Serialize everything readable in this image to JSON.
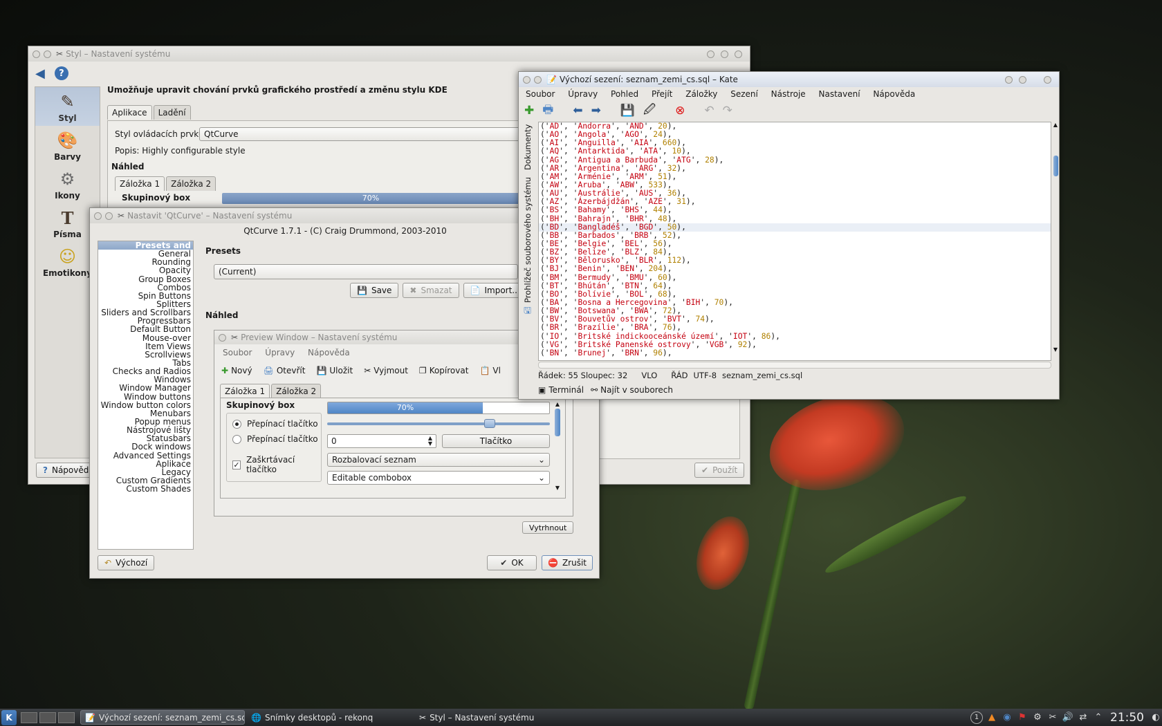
{
  "styl": {
    "title": "Styl – Nastavení systému",
    "heading": "Umožňuje upravit chování prvků grafického prostředí a změnu stylu KDE",
    "sidebar": [
      {
        "label": "Styl",
        "icon": "brush-icon"
      },
      {
        "label": "Barvy",
        "icon": "palette-icon"
      },
      {
        "label": "Ikony",
        "icon": "icons-icon"
      },
      {
        "label": "Písma",
        "icon": "font-icon"
      },
      {
        "label": "Emotikony",
        "icon": "smiley-icon"
      }
    ],
    "tabs": [
      "Aplikace",
      "Ladění"
    ],
    "widget_style_label": "Styl ovládacích prvků:",
    "widget_style_value": "QtCurve",
    "description": "Popis: Highly configurable style",
    "preview_label": "Náhled",
    "preview_tabs": [
      "Záložka 1",
      "Záložka 2"
    ],
    "groupbox": "Skupinový box",
    "progress": "70%",
    "help_button": "Nápověda",
    "apply_button": "Použít"
  },
  "qtcurve": {
    "title": "Nastavit 'QtCurve' – Nastavení systému",
    "header": "QtCurve 1.7.1 - (C) Craig Drummond, 2003-2010",
    "list": [
      "Presets and Preview",
      "General",
      "Rounding",
      "Opacity",
      "Group Boxes",
      "Combos",
      "Spin Buttons",
      "Splitters",
      "Sliders and Scrollbars",
      "Progressbars",
      "Default Button",
      "Mouse-over",
      "Item Views",
      "Scrollviews",
      "Tabs",
      "Checks and Radios",
      "Windows",
      "Window Manager",
      "Window buttons",
      "Window button colors",
      "Menubars",
      "Popup menus",
      "Nástrojové lišty",
      "Statusbars",
      "Dock windows",
      "Advanced Settings",
      "Aplikace",
      "Legacy",
      "Custom Gradients",
      "Custom Shades"
    ],
    "presets_label": "Presets",
    "preset_value": "(Current)",
    "save": "Save",
    "delete": "Smazat",
    "import": "Import...",
    "preview_label": "Náhled",
    "detach": "Vytrhnout",
    "default": "Výchozí",
    "ok": "OK",
    "cancel": "Zrušit"
  },
  "preview": {
    "title": "Preview Window – Nastavení systému",
    "menu": [
      "Soubor",
      "Úpravy",
      "Nápověda"
    ],
    "toolbar": [
      "Nový",
      "Otevřít",
      "Uložit",
      "Vyjmout",
      "Kopírovat",
      "Vl"
    ],
    "tabs": [
      "Záložka 1",
      "Záložka 2"
    ],
    "groupbox": "Skupinový box",
    "radio1": "Přepínací tlačítko",
    "radio2": "Přepínací tlačítko",
    "checkbox": "Zaškrtávací tlačítko",
    "progress_text": "70%",
    "progress": 0.7,
    "slider": 0.73,
    "spin_value": "0",
    "button": "Tlačítko",
    "combo1": "Rozbalovací seznam",
    "combo2": "Editable combobox"
  },
  "kate": {
    "title": "Výchozí sezení: seznam_zemi_cs.sql – Kate",
    "menu": [
      "Soubor",
      "Úpravy",
      "Pohled",
      "Přejít",
      "Záložky",
      "Sezení",
      "Nástroje",
      "Nastavení",
      "Nápověda"
    ],
    "side_tabs": [
      "Dokumenty",
      "Prohlížeč souborového systému"
    ],
    "lines": [
      [
        "AD",
        "Andorra",
        "AND",
        "20"
      ],
      [
        "AO",
        "Angola",
        "AGO",
        "24"
      ],
      [
        "AI",
        "Anguilla",
        "AIA",
        "660"
      ],
      [
        "AQ",
        "Antarktida",
        "ATA",
        "10"
      ],
      [
        "AG",
        "Antigua a Barbuda",
        "ATG",
        "28"
      ],
      [
        "AR",
        "Argentina",
        "ARG",
        "32"
      ],
      [
        "AM",
        "Arménie",
        "ARM",
        "51"
      ],
      [
        "AW",
        "Aruba",
        "ABW",
        "533"
      ],
      [
        "AU",
        "Austrálie",
        "AUS",
        "36"
      ],
      [
        "AZ",
        "Ázerbájdžán",
        "AZE",
        "31"
      ],
      [
        "BS",
        "Bahamy",
        "BHS",
        "44"
      ],
      [
        "BH",
        "Bahrajn",
        "BHR",
        "48"
      ],
      [
        "BD",
        "Bangladéš",
        "BGD",
        "50"
      ],
      [
        "BB",
        "Barbados",
        "BRB",
        "52"
      ],
      [
        "BE",
        "Belgie",
        "BEL",
        "56"
      ],
      [
        "BZ",
        "Belize",
        "BLZ",
        "84"
      ],
      [
        "BY",
        "Bělorusko",
        "BLR",
        "112"
      ],
      [
        "BJ",
        "Benin",
        "BEN",
        "204"
      ],
      [
        "BM",
        "Bermudy",
        "BMU",
        "60"
      ],
      [
        "BT",
        "Bhútán",
        "BTN",
        "64"
      ],
      [
        "BO",
        "Bolívie",
        "BOL",
        "68"
      ],
      [
        "BA",
        "Bosna a Hercegovina",
        "BIH",
        "70"
      ],
      [
        "BW",
        "Botswana",
        "BWA",
        "72"
      ],
      [
        "BV",
        "Bouvetův ostrov",
        "BVT",
        "74"
      ],
      [
        "BR",
        "Brazílie",
        "BRA",
        "76"
      ],
      [
        "IO",
        "Britské indickooceánské území",
        "IOT",
        "86"
      ],
      [
        "VG",
        "Britské Panenské ostrovy",
        "VGB",
        "92"
      ],
      [
        "BN",
        "Brunej",
        "BRN",
        "96"
      ]
    ],
    "status": "Řádek: 55 Sloupec: 32",
    "status_mode": "VLO",
    "status_wrap": "ŘÁD",
    "status_enc": "UTF-8",
    "status_file": "seznam_zemi_cs.sql",
    "bottom_tabs": [
      "Terminál",
      "Najít v souborech"
    ]
  },
  "taskbar": {
    "tasks": [
      "Výchozí sezení: seznam_zemi_cs.sql",
      "Snímky desktopů - rekonq",
      "Styl – Nastavení systému"
    ],
    "pager": "1",
    "clock": "21:50"
  },
  "colors": {
    "accent": "#4f86c6",
    "selection": "#8fa8c9",
    "string": "#c4000f",
    "number": "#b08000"
  }
}
